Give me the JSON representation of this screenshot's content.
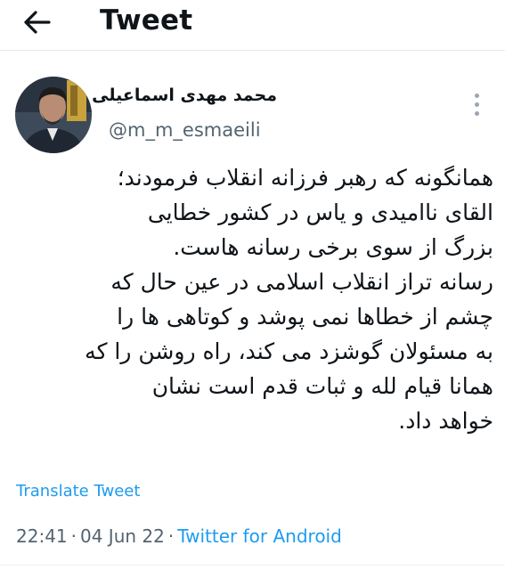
{
  "header": {
    "back_icon": "arrow-left-icon",
    "title": "Tweet"
  },
  "author": {
    "display_name": "محمد مهدی اسماعیلی",
    "handle": "@m_m_esmaeili",
    "more_icon": "more-vertical-icon"
  },
  "tweet": {
    "lines": [
      "همانگونه که رهبر فرزانه انقلاب فرمودند؛",
      "القای ناامیدی و یاس در کشور خطایی",
      "بزرگ از سوی برخی رسانه هاست.",
      "رسانه تراز انقلاب اسلامی در عین حال که",
      "چشم از خطاها نمی پوشد و کوتاهی ها را",
      "به مسئولان گوشزد می کند، راه روشن را که",
      "همانا قیام لله و ثبات قدم است نشان",
      "خواهد داد."
    ],
    "translate_label": "Translate Tweet",
    "time": "22:41",
    "separator": "·",
    "date": "04 Jun 22",
    "source": "Twitter for Android"
  },
  "colors": {
    "link": "#1d9bf0",
    "secondary_text": "#536471",
    "primary_text": "#0f1419"
  }
}
